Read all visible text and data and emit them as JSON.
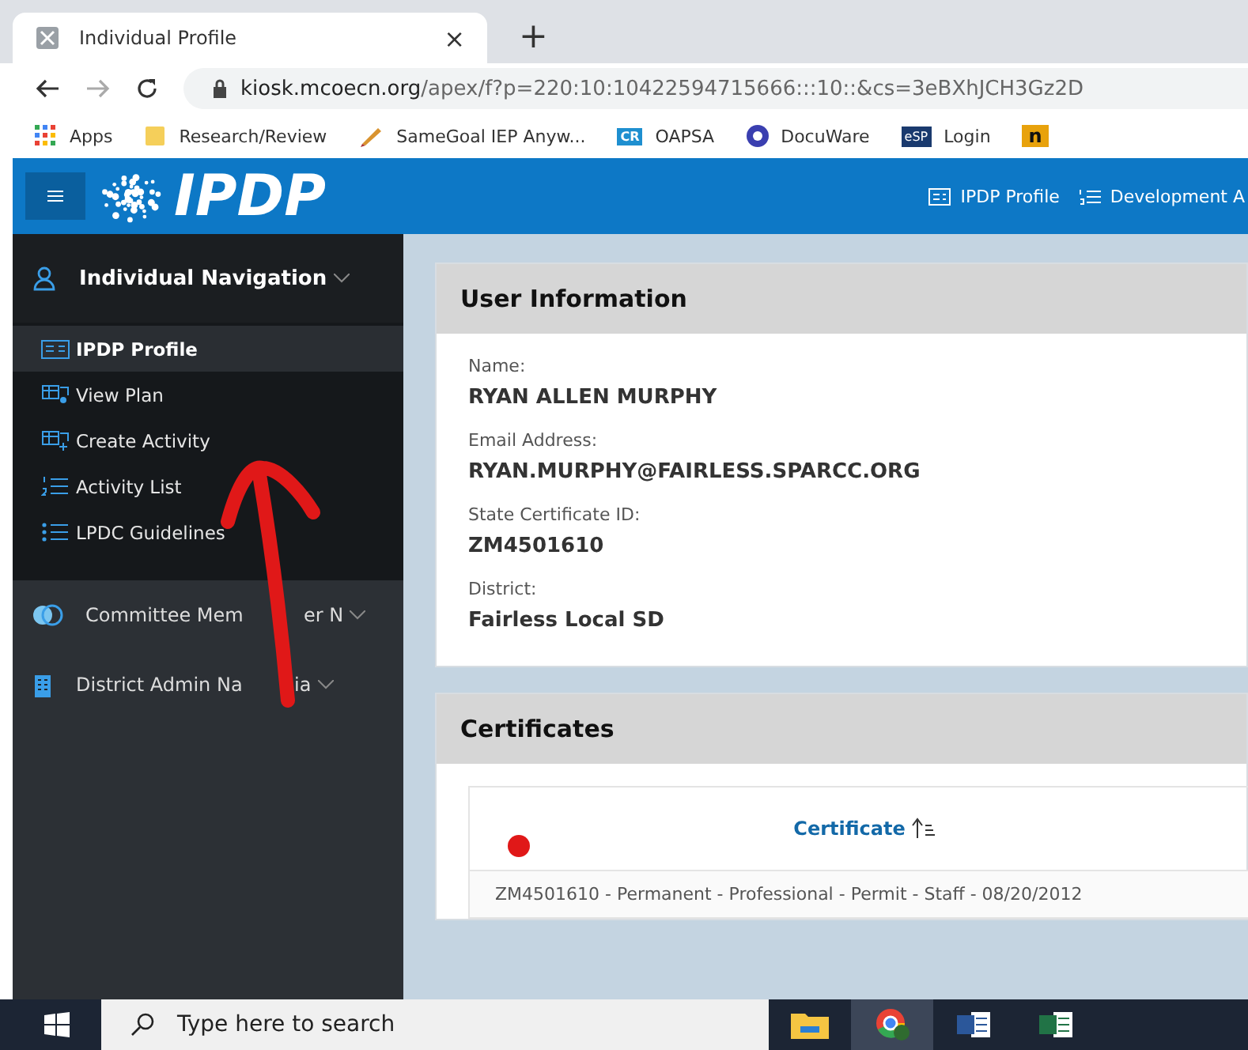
{
  "browser": {
    "tab": {
      "title": "Individual Profile",
      "close": "×"
    },
    "new_tab": "+",
    "url_host": "kiosk.mcoecn.org",
    "url_path": "/apex/f?p=220:10:10422594715666:::10::&cs=3eBXhJCH3Gz2D",
    "bookmarks": [
      {
        "label": "Apps",
        "kind": "apps"
      },
      {
        "label": "Research/Review",
        "kind": "folder"
      },
      {
        "label": "SameGoal IEP Anyw...",
        "kind": "pencil"
      },
      {
        "label": "OAPSA",
        "kind": "cr",
        "badge": "CR"
      },
      {
        "label": "DocuWare",
        "kind": "circle"
      },
      {
        "label": "Login",
        "kind": "esp",
        "badge": "eSP"
      },
      {
        "kind": "n",
        "badge": "n"
      }
    ]
  },
  "app": {
    "logo": "IPDP",
    "nav": [
      {
        "label": "IPDP Profile",
        "kind": "card"
      },
      {
        "label": "Development A",
        "kind": "list"
      }
    ]
  },
  "sidebar": [
    {
      "label": "Individual Navigation",
      "kind": "person",
      "expanded": true,
      "children": [
        {
          "label": "IPDP Profile",
          "kind": "card",
          "selected": true
        },
        {
          "label": "View Plan",
          "kind": "plan",
          "selected": false
        },
        {
          "label": "Create Activity",
          "kind": "create",
          "selected": false
        },
        {
          "label": "Activity List",
          "kind": "numlist",
          "selected": false
        },
        {
          "label": "LPDC Guidelines",
          "kind": "dotlist",
          "selected": false
        }
      ]
    },
    {
      "label": "Committee Mem",
      "after": "er N",
      "kind": "people",
      "expanded": false
    },
    {
      "label": "District Admin Na",
      "after": "ia",
      "kind": "building",
      "expanded": false
    }
  ],
  "user_info": {
    "title": "User Information",
    "fields": [
      {
        "label": "Name:",
        "value": "RYAN ALLEN MURPHY"
      },
      {
        "label": "Email Address:",
        "value": "RYAN.MURPHY@FAIRLESS.SPARCC.ORG"
      },
      {
        "label": "State Certificate ID:",
        "value": "ZM4501610"
      },
      {
        "label": "District:",
        "value": "Fairless Local SD"
      }
    ]
  },
  "certificates": {
    "title": "Certificates",
    "column": "Certificate",
    "rows": [
      "ZM4501610 - Permanent - Professional - Permit - Staff - 08/20/2012"
    ]
  },
  "taskbar": {
    "search_placeholder": "Type here to search",
    "apps": [
      {
        "kind": "folder",
        "selected": false
      },
      {
        "kind": "chrome",
        "selected": true
      },
      {
        "kind": "word",
        "selected": false
      },
      {
        "kind": "excel",
        "selected": false
      }
    ]
  }
}
